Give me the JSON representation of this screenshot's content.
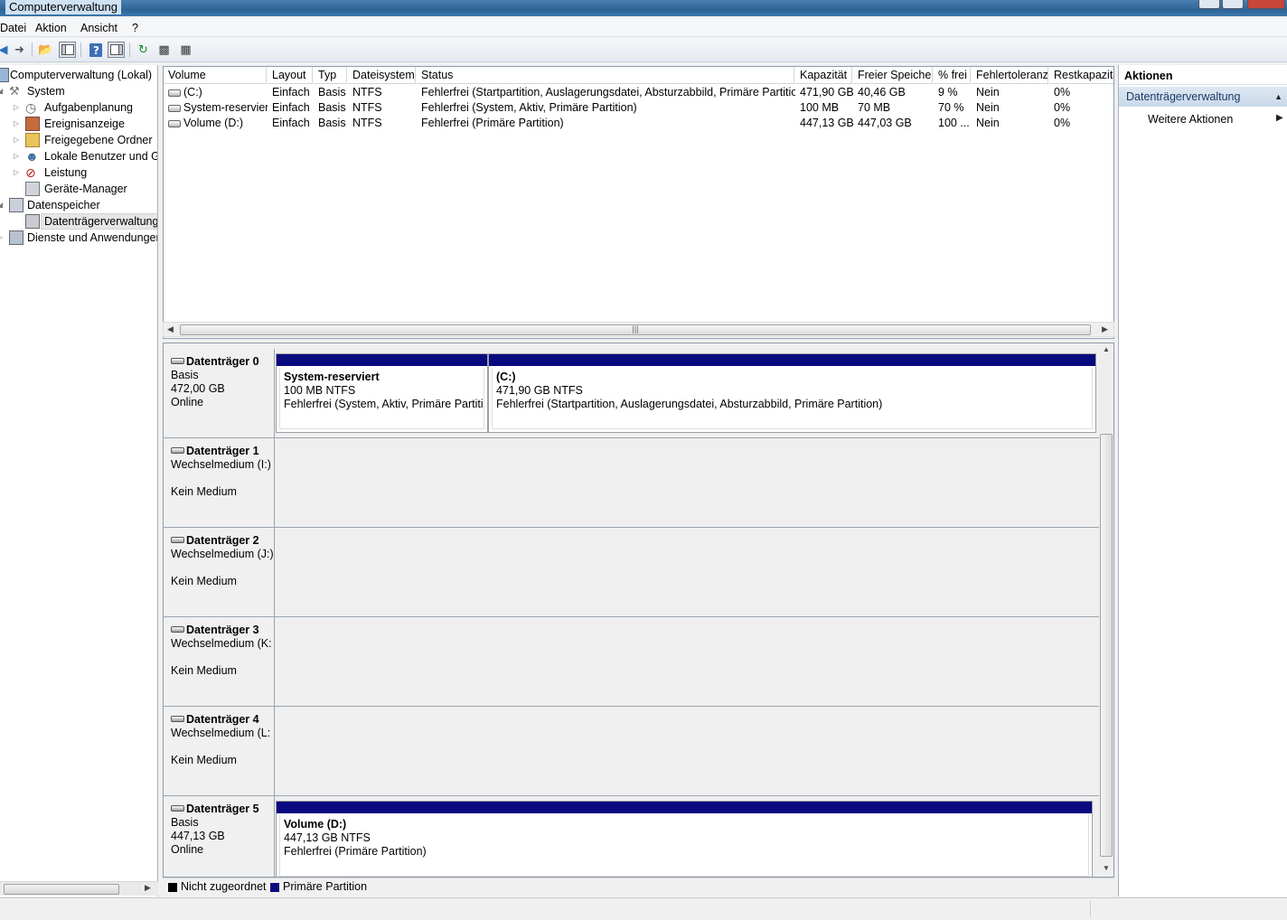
{
  "window": {
    "title": "Computerverwaltung"
  },
  "menu": [
    "Datei",
    "Aktion",
    "Ansicht",
    "?"
  ],
  "toolbar": {
    "buttons": [
      "back-icon",
      "forward-icon",
      "folder-up-icon",
      "show-hide-tree-icon",
      "help-icon",
      "show-hide-action-icon",
      "refresh-icon",
      "properties-icon",
      "export-icon"
    ]
  },
  "tree": {
    "root": "Computerverwaltung (Lokal)",
    "system": "System",
    "aufgabenplanung": "Aufgabenplanung",
    "ereignisanzeige": "Ereignisanzeige",
    "freigegebene_ordner": "Freigegebene Ordner",
    "lokale_benutzer": "Lokale Benutzer und Gr",
    "leistung": "Leistung",
    "geraete_manager": "Geräte-Manager",
    "datenspeicher": "Datenspeicher",
    "datentraegerverwaltung": "Datenträgerverwaltung",
    "dienste": "Dienste und Anwendungen"
  },
  "volumes": {
    "columns": [
      "Volume",
      "Layout",
      "Typ",
      "Dateisystem",
      "Status",
      "Kapazität",
      "Freier Speicher",
      "% frei",
      "Fehlertoleranz",
      "Restkapazität"
    ],
    "rows": [
      [
        "(C:)",
        "Einfach",
        "Basis",
        "NTFS",
        "Fehlerfrei (Startpartition, Auslagerungsdatei, Absturzabbild, Primäre Partition)",
        "471,90 GB",
        "40,46 GB",
        "9 %",
        "Nein",
        "0%"
      ],
      [
        "System-reserviert",
        "Einfach",
        "Basis",
        "NTFS",
        "Fehlerfrei (System, Aktiv, Primäre Partition)",
        "100 MB",
        "70 MB",
        "70 %",
        "Nein",
        "0%"
      ],
      [
        "Volume (D:)",
        "Einfach",
        "Basis",
        "NTFS",
        "Fehlerfrei (Primäre Partition)",
        "447,13 GB",
        "447,03 GB",
        "100 ...",
        "Nein",
        "0%"
      ]
    ]
  },
  "disks": [
    {
      "name": "Datenträger 0",
      "type": "Basis",
      "size": "472,00 GB",
      "state": "Online",
      "partitions": [
        {
          "title": "System-reserviert",
          "size": "100 MB NTFS",
          "status": "Fehlerfrei (System, Aktiv, Primäre Partition"
        },
        {
          "title": "(C:)",
          "size": "471,90 GB NTFS",
          "status": "Fehlerfrei (Startpartition, Auslagerungsdatei, Absturzabbild, Primäre Partition)"
        }
      ]
    },
    {
      "name": "Datenträger 1",
      "type": "Wechselmedium (I:)",
      "state": "Kein Medium"
    },
    {
      "name": "Datenträger 2",
      "type": "Wechselmedium (J:)",
      "state": "Kein Medium"
    },
    {
      "name": "Datenträger 3",
      "type": "Wechselmedium (K:",
      "state": "Kein Medium"
    },
    {
      "name": "Datenträger 4",
      "type": "Wechselmedium (L:",
      "state": "Kein Medium"
    },
    {
      "name": "Datenträger 5",
      "type": "Basis",
      "size": "447,13 GB",
      "state": "Online",
      "partitions": [
        {
          "title": "Volume  (D:)",
          "size": "447,13 GB NTFS",
          "status": "Fehlerfrei (Primäre Partition)"
        }
      ]
    }
  ],
  "legend": {
    "unallocated": "Nicht zugeordnet",
    "primary": "Primäre Partition",
    "unallocated_color": "#000000",
    "primary_color": "#0a0a80"
  },
  "actions": {
    "header": "Aktionen",
    "section": "Datenträgerverwaltung",
    "item": "Weitere Aktionen"
  }
}
